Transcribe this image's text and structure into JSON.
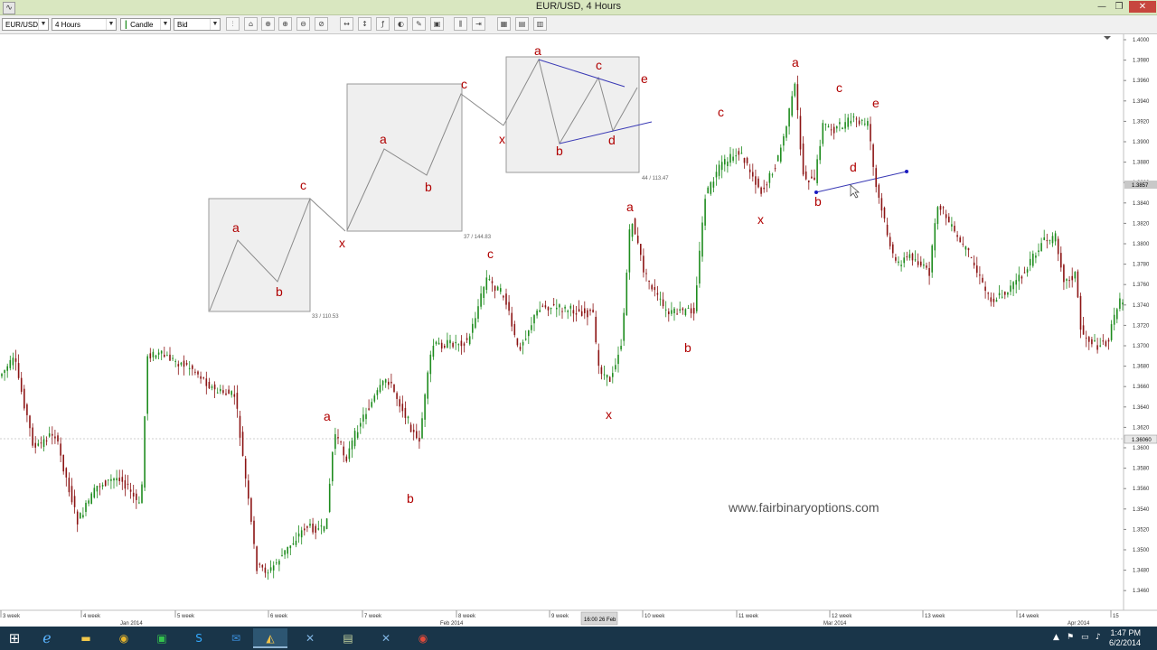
{
  "window": {
    "title": "EUR/USD,  4 Hours",
    "minimize": "—",
    "restore": "❐",
    "close": "✕"
  },
  "toolbar": {
    "symbol": "EUR/USD",
    "timeframe": "4 Hours",
    "chart_type": "Candle",
    "price_type": "Bid"
  },
  "chart": {
    "price_labels": [
      "1.4000",
      "1.3980",
      "1.3960",
      "1.3940",
      "1.3920",
      "1.3900",
      "1.3880",
      "1.3860",
      "1.3840",
      "1.3820",
      "1.3800",
      "1.3780",
      "1.3760",
      "1.3740",
      "1.3720",
      "1.3700",
      "1.3680",
      "1.3660",
      "1.3640",
      "1.3620",
      "1.3600",
      "1.3580",
      "1.3560",
      "1.3540",
      "1.3520",
      "1.3500",
      "1.3480",
      "1.3460"
    ],
    "current_price": "1.3857 ",
    "crosshair_price": "1.36060",
    "week_labels": [
      "3 week",
      "4 week",
      "5 week",
      "6 week",
      "7 week",
      "8 week",
      "9 week",
      "10 week",
      "11 week",
      "12 week",
      "13 week",
      "14 week",
      "15"
    ],
    "month_labels": [
      "Jan 2014",
      "Feb 2014",
      "Mar 2014",
      "Apr 2014"
    ],
    "crosshair_time": "16:00 26 Feb",
    "box_captions": [
      "33 / 110.53",
      "37 / 144.83",
      "44 / 113.47"
    ],
    "watermark": "www.fairbinaryoptions.com",
    "wave_labels": {
      "box1": [
        "a",
        "b",
        "c"
      ],
      "box2": [
        "x",
        "a",
        "b",
        "c"
      ],
      "box3": [
        "x",
        "a",
        "b",
        "c",
        "d",
        "e"
      ],
      "chart": [
        "a",
        "b",
        "c",
        "x",
        "a",
        "b",
        "c",
        "x",
        "a",
        "b",
        "c",
        "d",
        "e"
      ]
    },
    "colors": {
      "bull": "#1e8c1e",
      "bear": "#8c1414",
      "wave_label": "#b00000",
      "trendline": "#3a3ab5"
    }
  },
  "taskbar": {
    "time": "1:47 PM",
    "date": "6/2/2014",
    "icons": [
      "windows-logo",
      "internet-explorer",
      "file-explorer",
      "chrome",
      "store",
      "skype",
      "outlook",
      "trading-app",
      "app-x1",
      "app-calc",
      "app-x2",
      "chrome-2"
    ]
  }
}
